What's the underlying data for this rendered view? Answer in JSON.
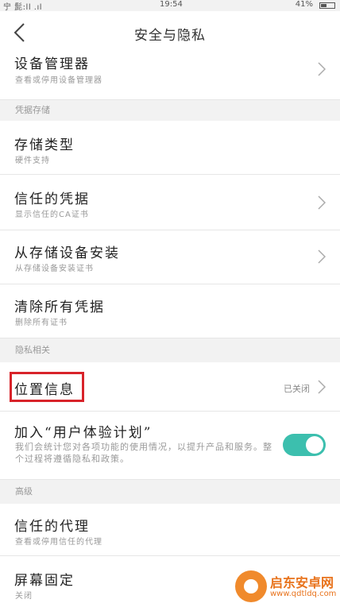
{
  "status_bar": {
    "signal": "宁 髭:ll .ıl",
    "time": "19:54",
    "battery": "41%"
  },
  "header": {
    "title": "安全与隐私"
  },
  "rows_top": [
    {
      "label": "设备管理器",
      "sub": "查看或停用设备管理器"
    }
  ],
  "sections": {
    "credentials": "凭据存储",
    "privacy": "隐私相关",
    "advanced": "高级"
  },
  "credential_rows": [
    {
      "label": "存储类型",
      "sub": "硬件支持"
    },
    {
      "label": "信任的凭据",
      "sub": "显示信任的CA证书"
    },
    {
      "label": "从存储设备安装",
      "sub": "从存储设备安装证书"
    },
    {
      "label": "清除所有凭据",
      "sub": "删除所有证书"
    }
  ],
  "privacy_rows": {
    "location": {
      "label": "位置信息",
      "value": "已关闭"
    },
    "ux_plan": {
      "label": "加入“用户体验计划”",
      "desc": "我们会统计您对各项功能的使用情况，以提升产品和服务。整个过程将遵循隐私和政策。",
      "enabled": true
    }
  },
  "advanced_rows": [
    {
      "label": "信任的代理",
      "sub": "查看或停用信任的代理"
    },
    {
      "label": "屏幕固定",
      "sub": "关闭"
    }
  ],
  "watermark": {
    "name": "启东安卓网",
    "url": "www.qdtldq.com"
  },
  "colors": {
    "accent": "#3cbfae",
    "highlight": "#d8232a"
  }
}
